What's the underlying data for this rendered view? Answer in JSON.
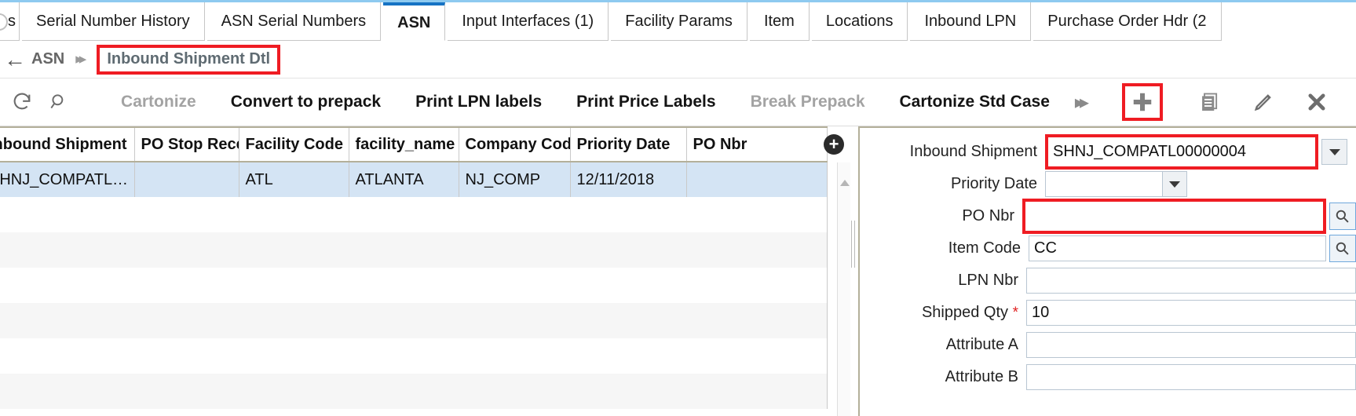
{
  "tabs": [
    {
      "label": "s",
      "active": false,
      "partial": true
    },
    {
      "label": "Serial Number History",
      "active": false
    },
    {
      "label": "ASN Serial Numbers",
      "active": false
    },
    {
      "label": "ASN",
      "active": true
    },
    {
      "label": "Input Interfaces (1)",
      "active": false
    },
    {
      "label": "Facility Params",
      "active": false
    },
    {
      "label": "Item",
      "active": false
    },
    {
      "label": "Locations",
      "active": false
    },
    {
      "label": "Inbound LPN",
      "active": false
    },
    {
      "label": "Purchase Order Hdr (2",
      "active": false
    }
  ],
  "breadcrumb": {
    "back_icon": "back-arrow-icon",
    "root": "ASN",
    "separator": "»",
    "current": "Inbound Shipment Dtl",
    "highlight_color": "#ef1c23"
  },
  "toolbar": {
    "refresh_icon": "↻",
    "search_icon": "search-icon",
    "actions": [
      {
        "label": "Cartonize",
        "disabled": true
      },
      {
        "label": "Convert to prepack",
        "disabled": false
      },
      {
        "label": "Print LPN labels",
        "disabled": false
      },
      {
        "label": "Print Price Labels",
        "disabled": false
      },
      {
        "label": "Break Prepack",
        "disabled": true
      },
      {
        "label": "Cartonize Std Case",
        "disabled": false
      }
    ],
    "more_icon": "»",
    "add_icon": "plus-icon",
    "add_highlighted": true,
    "copy_icon": "copy-icon",
    "edit_icon": "pencil-icon",
    "close_icon": "✖"
  },
  "grid": {
    "columns": [
      "Inbound Shipment",
      "PO Stop Receiv",
      "Facility Code",
      "facility_name",
      "Company Code",
      "Priority Date",
      "PO Nbr"
    ],
    "rows": [
      [
        "SHNJ_COMPATL…",
        "",
        "ATL",
        "ATLANTA",
        "NJ_COMP",
        "12/11/2018",
        ""
      ]
    ],
    "column_settings_icon": "plus-circle-icon",
    "selected_row_color": "#d4e4f4"
  },
  "form": {
    "fields": [
      {
        "label": "Inbound Shipment",
        "value": "SHNJ_COMPATL00000004",
        "type": "dropdown",
        "highlighted": true
      },
      {
        "label": "Priority Date",
        "value": "",
        "type": "dropdown-short",
        "highlighted": false
      },
      {
        "label": "PO Nbr",
        "value": "",
        "type": "lookup",
        "highlighted": true
      },
      {
        "label": "Item Code",
        "value": "CC",
        "type": "lookup",
        "highlighted": false
      },
      {
        "label": "LPN Nbr",
        "value": "",
        "type": "text",
        "highlighted": false
      },
      {
        "label": "Shipped Qty",
        "value": "10",
        "type": "text",
        "required": true,
        "highlighted": false
      },
      {
        "label": "Attribute A",
        "value": "",
        "type": "text",
        "highlighted": false
      },
      {
        "label": "Attribute B",
        "value": "",
        "type": "text",
        "highlighted": false
      }
    ]
  }
}
